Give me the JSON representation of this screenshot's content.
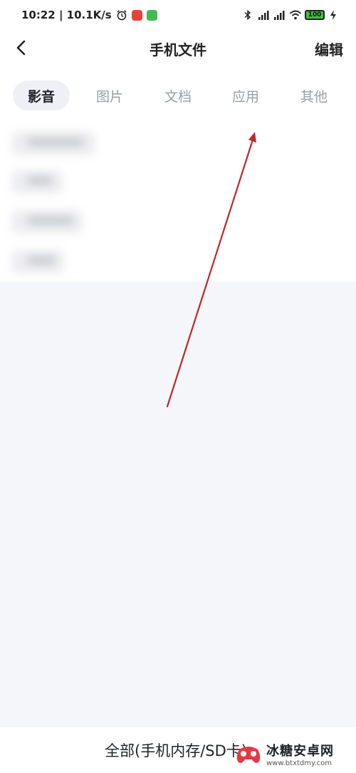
{
  "status_bar": {
    "time_speed": "10:22 | 10.1K/s",
    "battery": "100"
  },
  "nav": {
    "title": "手机文件",
    "edit_label": "编辑"
  },
  "tabs": [
    {
      "label": "影音",
      "active": true
    },
    {
      "label": "图片",
      "active": false
    },
    {
      "label": "文档",
      "active": false
    },
    {
      "label": "应用",
      "active": false
    },
    {
      "label": "其他",
      "active": false
    }
  ],
  "bottom": {
    "label": "全部(手机内存/SD卡)"
  },
  "watermark": {
    "name": "冰糖安卓网",
    "url": "www.btxtdmy.com"
  },
  "colors": {
    "accent": "#1f2125",
    "inactive_tab": "#9a9ea6",
    "arrow": "#c0262c",
    "battery_green": "#3cc13b",
    "background": "#f5f6fa"
  },
  "icons": {
    "back": "chevron-left-icon",
    "alarm": "alarm-icon",
    "bluetooth": "bluetooth-icon",
    "signal": "signal-icon",
    "wifi": "wifi-icon",
    "charging": "bolt-icon"
  }
}
